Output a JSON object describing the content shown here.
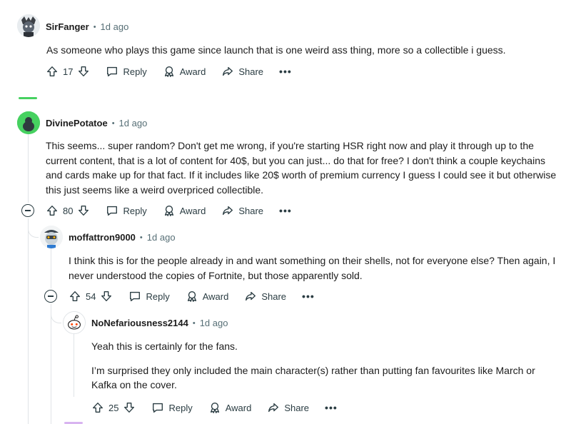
{
  "comments": [
    {
      "author": "SirFanger",
      "time": "1d ago",
      "body": [
        "As someone who plays this game since launch that is one weird ass thing, more so a collectible i guess."
      ],
      "votes": "17"
    },
    {
      "author": "DivinePotatoe",
      "time": "1d ago",
      "body": [
        "This seems... super random? Don't get me wrong, if you're starting HSR right now and play it through up to the current content, that is a lot of content for 40$, but you can just... do that for free? I don't think a couple keychains and cards make up for that fact. If it includes like 20$ worth of premium currency I guess I could see it but otherwise this just seems like a weird overpriced collectible."
      ],
      "votes": "80"
    },
    {
      "author": "moffattron9000",
      "time": "1d ago",
      "body": [
        "I think this is for the people already in and want something on their shells, not for everyone else? Then again, I never understood the copies of Fortnite, but those apparently sold."
      ],
      "votes": "54"
    },
    {
      "author": "NoNefariousness2144",
      "time": "1d ago",
      "body": [
        "Yeah this is certainly for the fans.",
        "I’m surprised they only included the main character(s) rather than putting fan favourites like March or Kafka on the cover."
      ],
      "votes": "25"
    }
  ],
  "actions": {
    "reply": "Reply",
    "award": "Award",
    "share": "Share",
    "more": "•••"
  },
  "separator": "•"
}
